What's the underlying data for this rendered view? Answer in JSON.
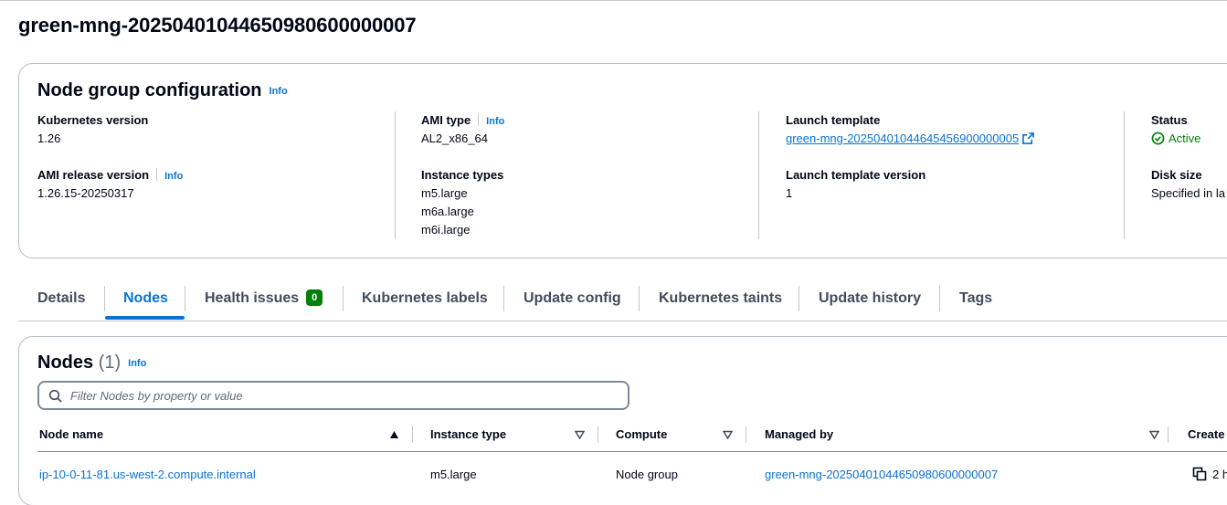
{
  "page": {
    "title": "green-mng-20250401044650980600000007"
  },
  "config": {
    "title": "Node group configuration",
    "info": "Info",
    "kubernetes_version": {
      "label": "Kubernetes version",
      "value": "1.26"
    },
    "ami_release_version": {
      "label": "AMI release version",
      "info": "Info",
      "value": "1.26.15-20250317"
    },
    "ami_type": {
      "label": "AMI type",
      "info": "Info",
      "value": "AL2_x86_64"
    },
    "instance_types": {
      "label": "Instance types",
      "values": [
        "m5.large",
        "m6a.large",
        "m6i.large"
      ]
    },
    "launch_template": {
      "label": "Launch template",
      "value": "green-mng-20250401044645456900000005"
    },
    "launch_template_version": {
      "label": "Launch template version",
      "value": "1"
    },
    "status": {
      "label": "Status",
      "value": "Active"
    },
    "disk_size": {
      "label": "Disk size",
      "value": "Specified in la"
    }
  },
  "tabs": [
    {
      "label": "Details"
    },
    {
      "label": "Nodes"
    },
    {
      "label": "Health issues",
      "badge": "0"
    },
    {
      "label": "Kubernetes labels"
    },
    {
      "label": "Update config"
    },
    {
      "label": "Kubernetes taints"
    },
    {
      "label": "Update history"
    },
    {
      "label": "Tags"
    }
  ],
  "nodes": {
    "title": "Nodes",
    "count": "(1)",
    "info": "Info",
    "search_placeholder": "Filter Nodes by property or value",
    "columns": [
      "Node name",
      "Instance type",
      "Compute",
      "Managed by",
      "Create"
    ],
    "rows": [
      {
        "node_name": "ip-10-0-11-81.us-west-2.compute.internal",
        "instance_type": "m5.large",
        "compute": "Node group",
        "managed_by": "green-mng-20250401044650980600000007",
        "created": "2 h"
      }
    ]
  },
  "colors": {
    "accent": "#0972d3",
    "success": "#037f0c",
    "text": "#000716"
  }
}
